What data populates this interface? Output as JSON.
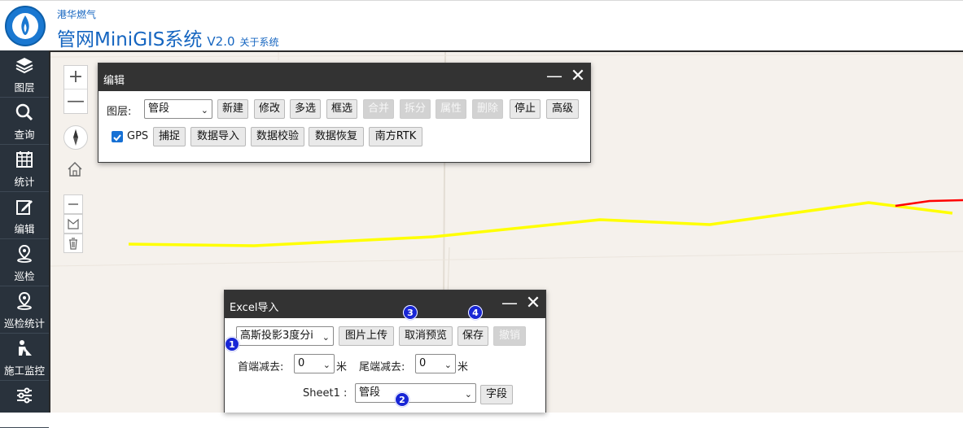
{
  "header": {
    "company": "港华燃气",
    "app_title": "管网MiniGIS系统",
    "version": "V2.0",
    "about_link": "关于系统",
    "brand_color": "#1565c0"
  },
  "sidebar": {
    "items": [
      {
        "label": "图层",
        "icon": "layers-icon"
      },
      {
        "label": "查询",
        "icon": "search-icon"
      },
      {
        "label": "统计",
        "icon": "calendar-grid-icon"
      },
      {
        "label": "编辑",
        "icon": "edit-icon"
      },
      {
        "label": "巡检",
        "icon": "location-pin-icon"
      },
      {
        "label": "巡检统计",
        "icon": "location-pin-icon"
      },
      {
        "label": "施工监控",
        "icon": "construction-worker-icon"
      },
      {
        "label": "",
        "icon": "sliders-icon"
      }
    ]
  },
  "map_controls": {
    "zoom_in": "+",
    "zoom_out": "—"
  },
  "edit_panel": {
    "title": "编辑",
    "layer_label": "图层:",
    "layer_value": "管段",
    "row1_buttons": [
      {
        "label": "新建",
        "disabled": false
      },
      {
        "label": "修改",
        "disabled": false
      },
      {
        "label": "多选",
        "disabled": false
      },
      {
        "label": "框选",
        "disabled": false
      },
      {
        "label": "合并",
        "disabled": true
      },
      {
        "label": "拆分",
        "disabled": true
      },
      {
        "label": "属性",
        "disabled": true
      },
      {
        "label": "删除",
        "disabled": true
      },
      {
        "label": "停止",
        "disabled": false
      },
      {
        "label": "高级",
        "disabled": false
      }
    ],
    "gps_label": "GPS",
    "gps_checked": true,
    "row2_buttons": [
      "捕捉",
      "数据导入",
      "数据校验",
      "数据恢复",
      "南方RTK"
    ]
  },
  "excel_panel": {
    "title": "Excel导入",
    "projection_value": "高斯投影3度分i",
    "buttons": [
      {
        "label": "图片上传",
        "disabled": false
      },
      {
        "label": "取消预览",
        "disabled": false
      },
      {
        "label": "保存",
        "disabled": false
      },
      {
        "label": "撤销",
        "disabled": true
      }
    ],
    "head_reduce_label": "首端减去:",
    "head_reduce_value": "0",
    "tail_reduce_label": "尾端减去:",
    "tail_reduce_value": "0",
    "unit": "米",
    "sheet_label": "Sheet1 :",
    "sheet_value": "管段",
    "field_button": "字段",
    "badges": [
      "1",
      "2",
      "3",
      "4"
    ]
  },
  "colors": {
    "sidebar_bg": "#29323c",
    "map_bg": "#f5f1ec",
    "pipeline_yellow": "#ffff00",
    "pipeline_red": "#ff0000",
    "badge_blue": "#1826d6"
  }
}
